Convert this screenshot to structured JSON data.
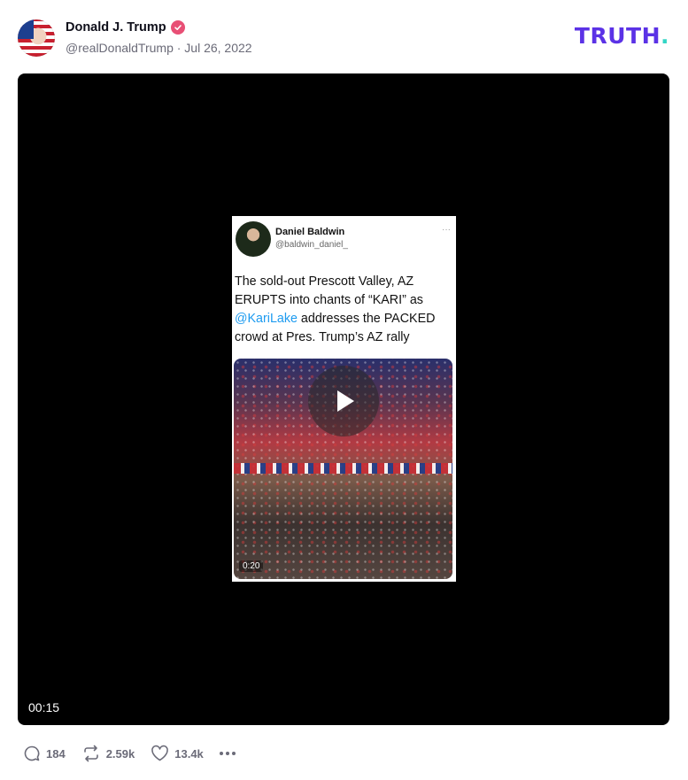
{
  "post": {
    "author_name": "Donald J. Trump",
    "handle_date": "@realDonaldTrump · Jul 26, 2022",
    "logo_text": "TRUTH",
    "logo_dot": ".",
    "verified_icon": "verified-badge-icon"
  },
  "video": {
    "duration": "00:15",
    "embedded": {
      "name": "Daniel Baldwin",
      "handle": "@baldwin_daniel_",
      "menu": "···",
      "text_before": "The sold-out Prescott Valley, AZ ERUPTS into chants of “KARI” as ",
      "mention": "@KariLake",
      "text_after": " addresses the PACKED crowd at Pres. Trump’s AZ rally",
      "clip_time": "0:20"
    }
  },
  "actions": {
    "replies": "184",
    "retruths": "2.59k",
    "likes": "13.4k"
  },
  "colors": {
    "brand": "#5b32e6",
    "brand_dot": "#33d6c6",
    "verified": "#e84f75",
    "muted": "#6b6b78"
  }
}
